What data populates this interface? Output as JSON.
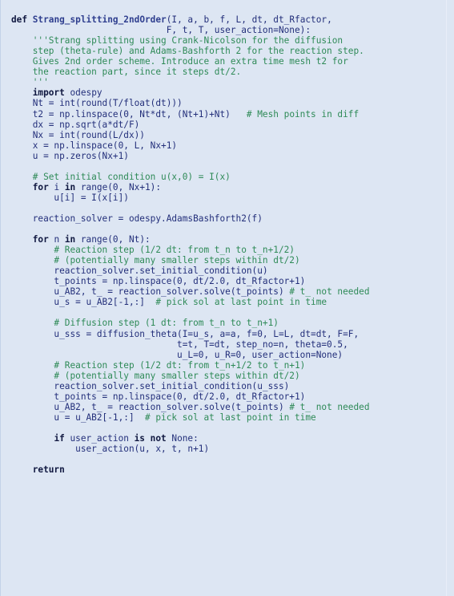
{
  "listing": {
    "language": "Python",
    "background_color": "#dde6f3",
    "text_color": "#232f7a",
    "keyword_color": "#101840",
    "comment_color": "#2e8a57",
    "function_name_color": "#2f3f8f",
    "lines": [
      {
        "indent": 0,
        "tokens": [
          {
            "t": "kw",
            "v": "def"
          },
          {
            "t": "nm",
            "v": " "
          },
          {
            "t": "nf",
            "v": "Strang_splitting_2ndOrder"
          },
          {
            "t": "nm",
            "v": "(I, a, b, f, L, dt, dt_Rfactor,"
          }
        ]
      },
      {
        "indent": 0,
        "tokens": [
          {
            "t": "nm",
            "v": "                             F, t, T, user_action=None):"
          }
        ]
      },
      {
        "indent": 0,
        "tokens": [
          {
            "t": "ds",
            "v": "    '''Strang splitting using Crank-Nicolson for the diffusion"
          }
        ]
      },
      {
        "indent": 0,
        "tokens": [
          {
            "t": "ds",
            "v": "    step (theta-rule) and Adams-Bashforth 2 for the reaction step."
          }
        ]
      },
      {
        "indent": 0,
        "tokens": [
          {
            "t": "ds",
            "v": "    Gives 2nd order scheme. Introduce an extra time mesh t2 for"
          }
        ]
      },
      {
        "indent": 0,
        "tokens": [
          {
            "t": "ds",
            "v": "    the reaction part, since it steps dt/2."
          }
        ]
      },
      {
        "indent": 0,
        "tokens": [
          {
            "t": "ds",
            "v": "    '''"
          }
        ]
      },
      {
        "indent": 0,
        "tokens": [
          {
            "t": "nm",
            "v": "    "
          },
          {
            "t": "kw",
            "v": "import"
          },
          {
            "t": "nm",
            "v": " odespy"
          }
        ]
      },
      {
        "indent": 0,
        "tokens": [
          {
            "t": "nm",
            "v": "    Nt = int(round(T/float(dt)))"
          }
        ]
      },
      {
        "indent": 0,
        "tokens": [
          {
            "t": "nm",
            "v": "    t2 = np.linspace(0, Nt*dt, (Nt+1)+Nt)   "
          },
          {
            "t": "cm",
            "v": "# Mesh points in diff"
          }
        ]
      },
      {
        "indent": 0,
        "tokens": [
          {
            "t": "nm",
            "v": "    dx = np.sqrt(a*dt/F)"
          }
        ]
      },
      {
        "indent": 0,
        "tokens": [
          {
            "t": "nm",
            "v": "    Nx = int(round(L/dx))"
          }
        ]
      },
      {
        "indent": 0,
        "tokens": [
          {
            "t": "nm",
            "v": "    x = np.linspace(0, L, Nx+1)"
          }
        ]
      },
      {
        "indent": 0,
        "tokens": [
          {
            "t": "nm",
            "v": "    u = np.zeros(Nx+1)"
          }
        ]
      },
      {
        "indent": 0,
        "tokens": []
      },
      {
        "indent": 0,
        "tokens": [
          {
            "t": "cm",
            "v": "    # Set initial condition u(x,0) = I(x)"
          }
        ]
      },
      {
        "indent": 0,
        "tokens": [
          {
            "t": "nm",
            "v": "    "
          },
          {
            "t": "kw",
            "v": "for"
          },
          {
            "t": "nm",
            "v": " i "
          },
          {
            "t": "kw",
            "v": "in"
          },
          {
            "t": "nm",
            "v": " range(0, Nx+1):"
          }
        ]
      },
      {
        "indent": 0,
        "tokens": [
          {
            "t": "nm",
            "v": "        u[i] = I(x[i])"
          }
        ]
      },
      {
        "indent": 0,
        "tokens": []
      },
      {
        "indent": 0,
        "tokens": [
          {
            "t": "nm",
            "v": "    reaction_solver = odespy.AdamsBashforth2(f)"
          }
        ]
      },
      {
        "indent": 0,
        "tokens": []
      },
      {
        "indent": 0,
        "tokens": [
          {
            "t": "nm",
            "v": "    "
          },
          {
            "t": "kw",
            "v": "for"
          },
          {
            "t": "nm",
            "v": " n "
          },
          {
            "t": "kw",
            "v": "in"
          },
          {
            "t": "nm",
            "v": " range(0, Nt):"
          }
        ]
      },
      {
        "indent": 0,
        "tokens": [
          {
            "t": "cm",
            "v": "        # Reaction step (1/2 dt: from t_n to t_n+1/2)"
          }
        ]
      },
      {
        "indent": 0,
        "tokens": [
          {
            "t": "cm",
            "v": "        # (potentially many smaller steps within dt/2)"
          }
        ]
      },
      {
        "indent": 0,
        "tokens": [
          {
            "t": "nm",
            "v": "        reaction_solver.set_initial_condition(u)"
          }
        ]
      },
      {
        "indent": 0,
        "tokens": [
          {
            "t": "nm",
            "v": "        t_points = np.linspace(0, dt/2.0, dt_Rfactor+1)"
          }
        ]
      },
      {
        "indent": 0,
        "tokens": [
          {
            "t": "nm",
            "v": "        u_AB2, t_ = reaction_solver.solve(t_points) "
          },
          {
            "t": "cm",
            "v": "# t_ not needed"
          }
        ]
      },
      {
        "indent": 0,
        "tokens": [
          {
            "t": "nm",
            "v": "        u_s = u_AB2[-1,:]  "
          },
          {
            "t": "cm",
            "v": "# pick sol at last point in time"
          }
        ]
      },
      {
        "indent": 0,
        "tokens": []
      },
      {
        "indent": 0,
        "tokens": [
          {
            "t": "cm",
            "v": "        # Diffusion step (1 dt: from t_n to t_n+1)"
          }
        ]
      },
      {
        "indent": 0,
        "tokens": [
          {
            "t": "nm",
            "v": "        u_sss = diffusion_theta(I=u_s, a=a, f=0, L=L, dt=dt, F=F,"
          }
        ]
      },
      {
        "indent": 0,
        "tokens": [
          {
            "t": "nm",
            "v": "                               t=t, T=dt, step_no=n, theta=0.5,"
          }
        ]
      },
      {
        "indent": 0,
        "tokens": [
          {
            "t": "nm",
            "v": "                               u_L=0, u_R=0, user_action=None)"
          }
        ]
      },
      {
        "indent": 0,
        "tokens": [
          {
            "t": "cm",
            "v": "        # Reaction step (1/2 dt: from t_n+1/2 to t_n+1)"
          }
        ]
      },
      {
        "indent": 0,
        "tokens": [
          {
            "t": "cm",
            "v": "        # (potentially many smaller steps within dt/2)"
          }
        ]
      },
      {
        "indent": 0,
        "tokens": [
          {
            "t": "nm",
            "v": "        reaction_solver.set_initial_condition(u_sss)"
          }
        ]
      },
      {
        "indent": 0,
        "tokens": [
          {
            "t": "nm",
            "v": "        t_points = np.linspace(0, dt/2.0, dt_Rfactor+1)"
          }
        ]
      },
      {
        "indent": 0,
        "tokens": [
          {
            "t": "nm",
            "v": "        u_AB2, t_ = reaction_solver.solve(t_points) "
          },
          {
            "t": "cm",
            "v": "# t_ not needed"
          }
        ]
      },
      {
        "indent": 0,
        "tokens": [
          {
            "t": "nm",
            "v": "        u = u_AB2[-1,:]  "
          },
          {
            "t": "cm",
            "v": "# pick sol at last point in time"
          }
        ]
      },
      {
        "indent": 0,
        "tokens": []
      },
      {
        "indent": 0,
        "tokens": [
          {
            "t": "nm",
            "v": "        "
          },
          {
            "t": "kw",
            "v": "if"
          },
          {
            "t": "nm",
            "v": " user_action "
          },
          {
            "t": "kw",
            "v": "is"
          },
          {
            "t": "nm",
            "v": " "
          },
          {
            "t": "kw",
            "v": "not"
          },
          {
            "t": "nm",
            "v": " None:"
          }
        ]
      },
      {
        "indent": 0,
        "tokens": [
          {
            "t": "nm",
            "v": "            user_action(u, x, t, n+1)"
          }
        ]
      },
      {
        "indent": 0,
        "tokens": []
      },
      {
        "indent": 0,
        "tokens": [
          {
            "t": "nm",
            "v": "    "
          },
          {
            "t": "kw",
            "v": "return"
          }
        ]
      }
    ]
  }
}
